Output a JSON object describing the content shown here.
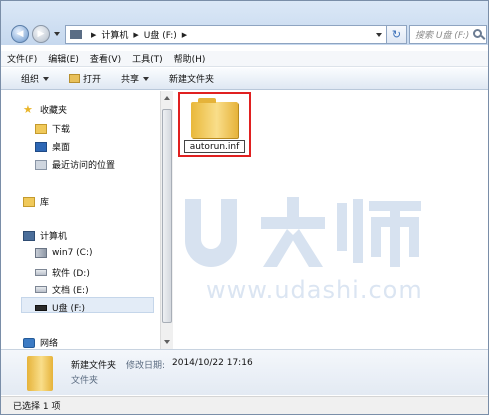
{
  "address": {
    "crumbs": [
      "计算机",
      "U盘 (F:)"
    ],
    "search_placeholder": "搜索 U盘 (F:)"
  },
  "menu": [
    "文件(F)",
    "编辑(E)",
    "查看(V)",
    "工具(T)",
    "帮助(H)"
  ],
  "toolbar": {
    "organize": "组织",
    "open": "打开",
    "share": "共享",
    "new_folder": "新建文件夹"
  },
  "sidebar": {
    "favorites": "收藏夹",
    "downloads": "下载",
    "desktop": "桌面",
    "recent": "最近访问的位置",
    "libraries": "库",
    "computer": "计算机",
    "drives": [
      "win7 (C:)",
      "软件 (D:)",
      "文档 (E:)",
      "U盘 (F:)"
    ],
    "network": "网络"
  },
  "content": {
    "file_name": "autorun.inf"
  },
  "watermark": {
    "logo": "U大师",
    "url": "www.udashi.com"
  },
  "details": {
    "name": "新建文件夹",
    "modified_label": "修改日期:",
    "modified_value": "2014/10/22 17:16",
    "type": "文件夹"
  },
  "statusbar": {
    "text": "已选择 1 项"
  },
  "colors": {
    "highlight_border": "#e02020",
    "watermark": "#dbe5f2"
  }
}
